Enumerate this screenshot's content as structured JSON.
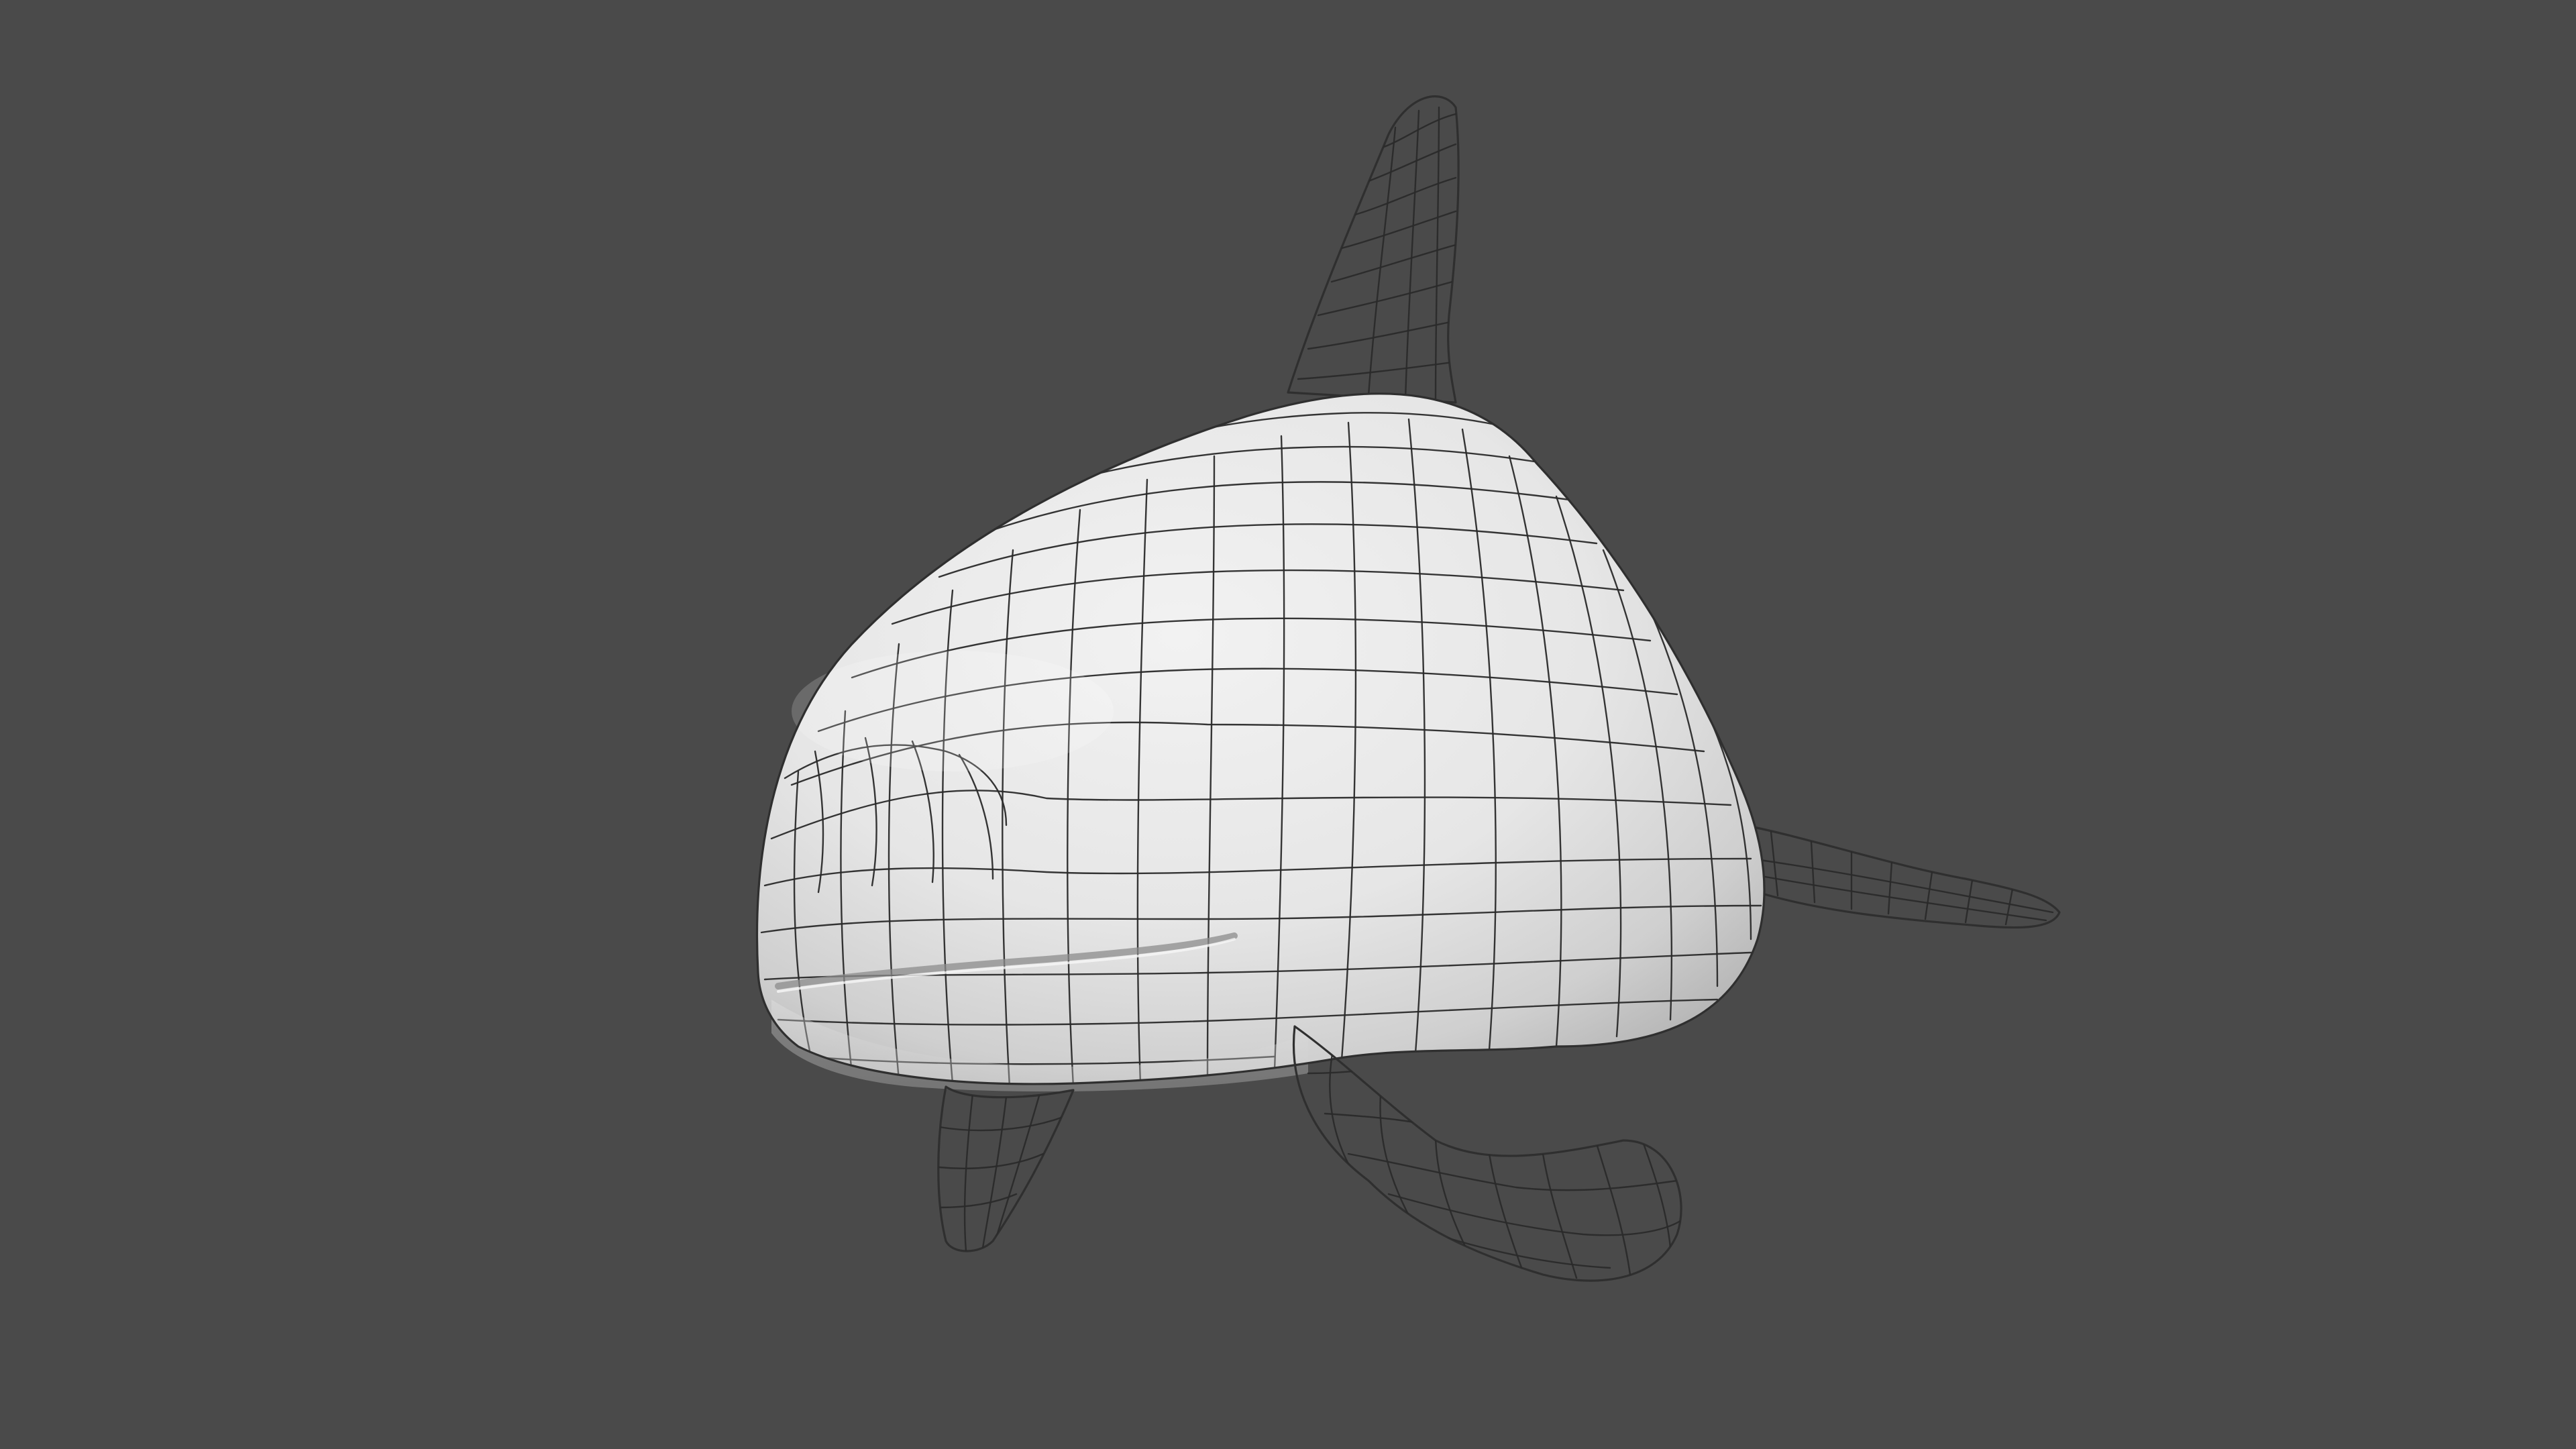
{
  "scene": {
    "subject": "dolphin-wireframe-model",
    "background_color": "#4a4a4a",
    "mesh_color": "#e9e9e9",
    "wire_color": "#2a2a2a"
  }
}
